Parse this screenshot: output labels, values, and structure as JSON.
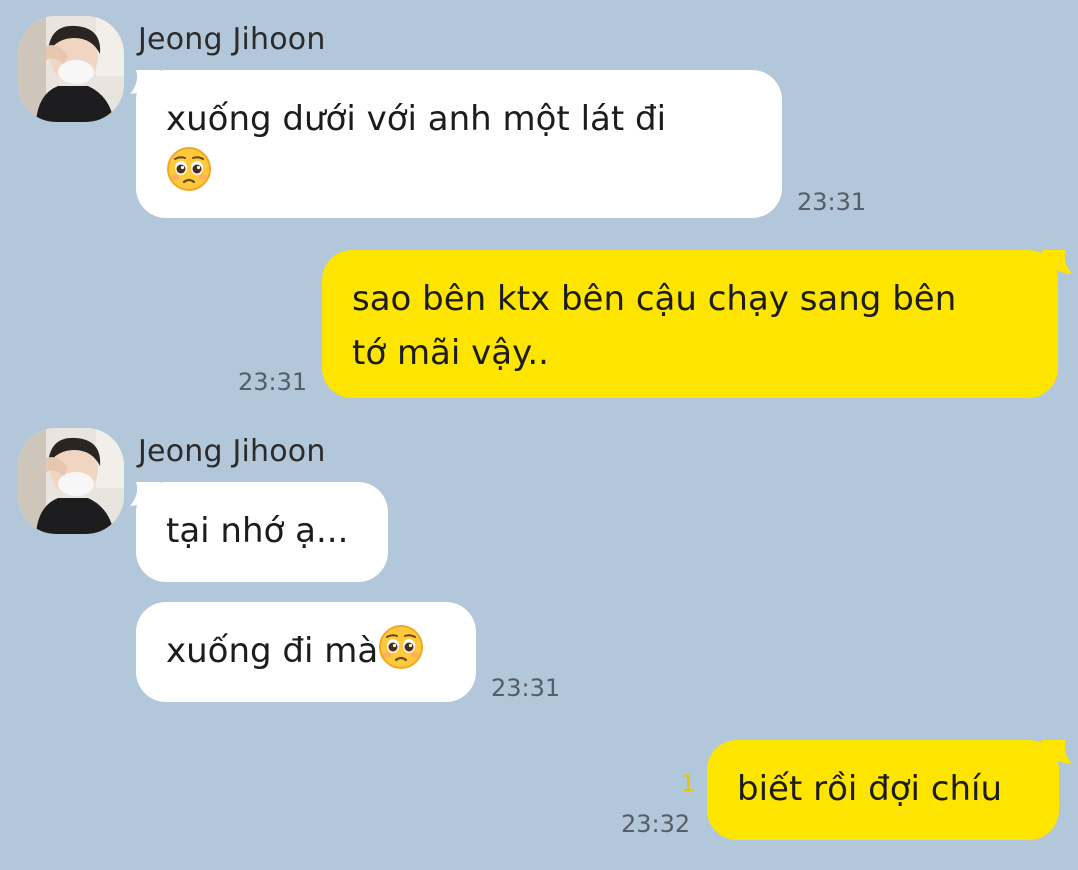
{
  "background_color": "#b2c7da",
  "bubble_colors": {
    "incoming": "#ffffff",
    "outgoing": "#fee500"
  },
  "messages": [
    {
      "sender": "Jeong Jihoon",
      "text": "xuống dưới với anh một lát đi",
      "emoji": "pleading-face",
      "time": "23:31"
    },
    {
      "text": "sao bên ktx bên cậu chạy sang bên",
      "text2": "tớ mãi vậy..",
      "time": "23:31"
    },
    {
      "sender": "Jeong Jihoon",
      "text": "tại nhớ ạ..."
    },
    {
      "text": "xuống đi mà",
      "emoji": "pleading-face",
      "time": "23:31"
    },
    {
      "text": "biết rồi đợi chíu",
      "time": "23:32",
      "unread_count": "1"
    }
  ]
}
